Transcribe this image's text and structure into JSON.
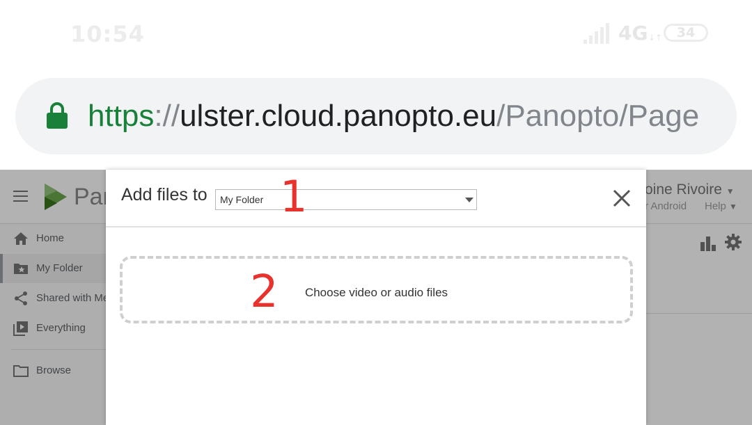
{
  "status_bar": {
    "time": "10:54",
    "network_type": "4G",
    "network_arrows": "↓↑",
    "battery_level": "34",
    "icons": [
      "signal-icon",
      "battery-icon"
    ]
  },
  "browser": {
    "url_scheme": "https",
    "url_separator": "://",
    "url_host": "ulster.cloud.panopto.eu",
    "url_path": "/Panopto/Page",
    "lock_color": "#188038"
  },
  "app": {
    "brand_text": "Pan",
    "user_name": "oine Rivoire",
    "app_link": "r Android",
    "help_link": "Help",
    "sidebar": {
      "items": [
        {
          "label": "Home",
          "icon": "home-icon"
        },
        {
          "label": "My Folder",
          "icon": "folder-star-icon",
          "active": true
        },
        {
          "label": "Shared with Me",
          "icon": "share-icon"
        },
        {
          "label": "Everything",
          "icon": "video-library-icon"
        },
        {
          "label": "Browse",
          "icon": "folder-icon"
        }
      ]
    }
  },
  "dialog": {
    "title": "Add files to",
    "folder_select_value": "My Folder",
    "drop_zone_text": "Choose video or audio files",
    "close_icon": "close-icon"
  },
  "annotations": {
    "step_1": "1",
    "step_2": "2",
    "color": "#e8322d"
  }
}
